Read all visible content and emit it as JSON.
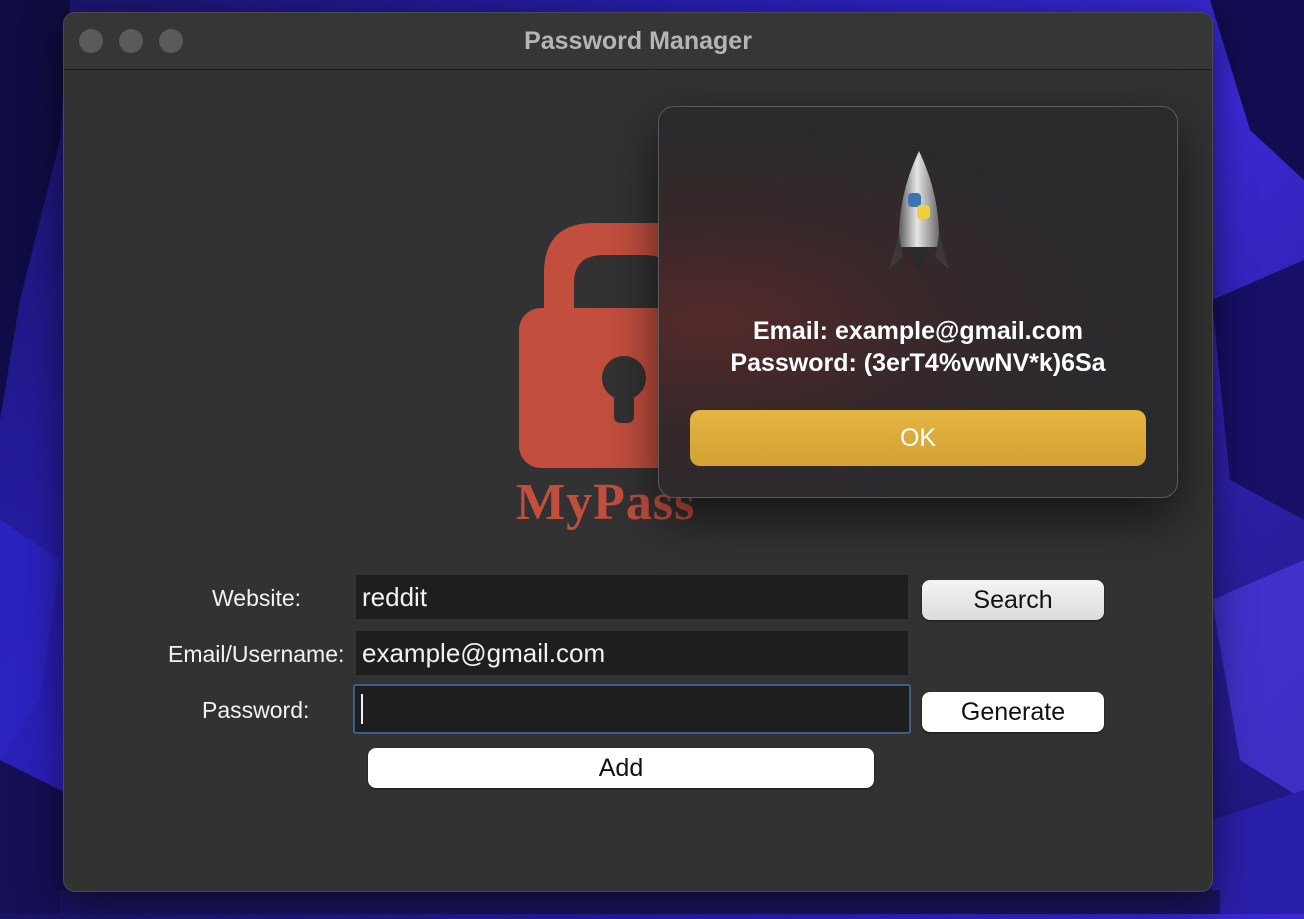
{
  "window": {
    "title": "Password Manager"
  },
  "logo": {
    "text": "MyPass"
  },
  "form": {
    "website_label": "Website:",
    "website_value": "reddit",
    "email_label": "Email/Username:",
    "email_value": "example@gmail.com",
    "password_label": "Password:",
    "password_value": "",
    "search_button": "Search",
    "generate_button": "Generate",
    "add_button": "Add"
  },
  "dialog": {
    "email_line": "Email: example@gmail.com",
    "password_line": "Password: (3erT4%vwNV*k)6Sa",
    "ok_button": "OK",
    "icon": "python-rocket-icon"
  },
  "colors": {
    "accent": "#d9aa39",
    "logo_red": "#c24e3e",
    "focus_ring": "#3e5f8a"
  }
}
